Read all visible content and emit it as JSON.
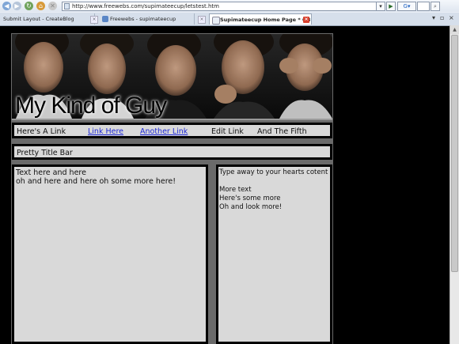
{
  "browser": {
    "address": "http://www.freewebs.com/supimateecup/letstest.htm",
    "tabs": [
      {
        "label": "Submit Layout - CreateBlog"
      },
      {
        "label": "Freewebs - supimateecup"
      },
      {
        "label": "Supimateecup Home Page * OB T..."
      }
    ]
  },
  "banner": {
    "title": "My Kind of Guy"
  },
  "nav": {
    "links": [
      {
        "label": "Here's A Link"
      },
      {
        "label": "Link Here"
      },
      {
        "label": "Another Link"
      },
      {
        "label": "Edit Link"
      },
      {
        "label": "And The Fifth"
      }
    ]
  },
  "title_bar": "Pretty Title Bar",
  "left_column": {
    "line1": "Text here and here",
    "line2": "oh and here and here oh some more here!"
  },
  "right_column": {
    "line1": "Type away to your hearts cotent",
    "line2": "More text",
    "line3": "Here's some more",
    "line4": "Oh and look more!"
  },
  "colors": {
    "background": "#000000",
    "box": "#d9d9d9",
    "link": "#1d27d6"
  }
}
